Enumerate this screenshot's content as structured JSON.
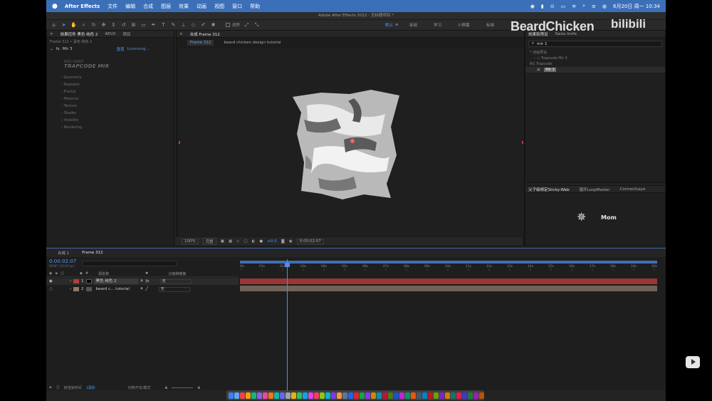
{
  "menubar": {
    "app": "After Effects",
    "items": [
      "文件",
      "编辑",
      "合成",
      "图层",
      "效果",
      "动画",
      "视图",
      "窗口",
      "帮助"
    ],
    "datetime": "6月20日 周一 10:34"
  },
  "titlebar": {
    "title": "Adobe After Effects 2022 - 无标题项目 *"
  },
  "toolbar": {
    "align_label": "对齐",
    "workspaces": [
      "默认",
      "审阅",
      "学习",
      "小屏幕",
      "标准"
    ]
  },
  "effect_controls": {
    "tabs": [
      "效果控件 黑色 纯色 2",
      "AEUX",
      "项目"
    ],
    "breadcrumb": "Frame 312 • 黑色 纯色 2",
    "effect_name": "Mir 3",
    "reset_label": "重置",
    "licensing_label": "Licensing...",
    "logo_top": "RED GIANT",
    "logo_main": "TRAPCODE MIR",
    "groups": [
      "Geometry",
      "Repeater",
      "Fractal",
      "Material",
      "Texture",
      "Shader",
      "Visibility",
      "Rendering"
    ]
  },
  "composition": {
    "tab_label": "合成 Frame 312",
    "sub_tabs": [
      "Frame 312",
      "beard chicken design tutorial"
    ],
    "zoom": "100%",
    "quality": "完整",
    "exposure": "+0.0",
    "timecode": "0:00:02:07"
  },
  "effects_presets": {
    "tabs": [
      "效果和预设",
      "Swiss knife"
    ],
    "search_value": "mir 1",
    "rows": [
      "* 动画预设",
      "Trapcode Mir 3",
      "RG Trapcode"
    ],
    "badge": "Mir 3"
  },
  "lower_right_panel": {
    "tabs": [
      "父子级绑定Sticky-Web",
      "循环LoopMaster",
      "ConnectLaye"
    ],
    "logo_text": "Mom"
  },
  "timeline": {
    "tabs": [
      "合成 1",
      "Frame 312"
    ],
    "timecode": "0:00:02:07",
    "timecode_sub": "00067 (30.00 fps)",
    "header_labels": {
      "num": "#",
      "source": "源名称",
      "parent": "父级和链接"
    },
    "layers": [
      {
        "num": "1",
        "name": "黑色 纯色 2",
        "parent": "无",
        "color": "#b33c3c"
      },
      {
        "num": "2",
        "name": "beard c... tutorial",
        "parent": "无",
        "color": "#8c7a68"
      }
    ],
    "ruler_ticks": [
      "00s",
      "01s",
      "02s",
      "03s",
      "04s",
      "05s",
      "06s",
      "07s",
      "08s",
      "09s",
      "10s",
      "11s",
      "12s",
      "13s",
      "14s",
      "15s",
      "16s",
      "17s",
      "18s",
      "19s",
      "20s"
    ],
    "footer": {
      "render_label": "帧渲染时间",
      "render_value": "1毫秒",
      "switch_label": "切换开关/模式"
    }
  },
  "watermark": {
    "text": "BeardChicken",
    "platform": "bilibili"
  },
  "colors": {
    "accent": "#3d8ff5",
    "menubar": "#3b6fb8",
    "layer1": "#b33c3c",
    "layer2": "#8c7a68"
  }
}
